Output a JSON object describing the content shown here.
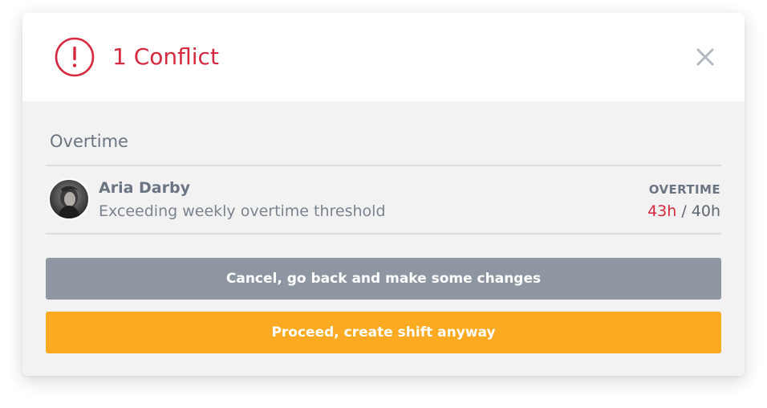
{
  "dialog": {
    "title": "1 Conflict",
    "alert_icon": "exclamation-circle-icon",
    "close_icon": "close-icon",
    "accent_color": "#d6283e"
  },
  "section": {
    "title": "Overtime"
  },
  "conflict": {
    "employee_name": "Aria Darby",
    "avatar": "employee-photo",
    "detail": "Exceeding weekly overtime threshold",
    "label": "OVERTIME",
    "current_hours": "43h",
    "separator": " / ",
    "limit_hours": "40h"
  },
  "actions": {
    "cancel_label": "Cancel, go back and make some changes",
    "cancel_color": "#8e97a1",
    "proceed_label": "Proceed, create shift anyway",
    "proceed_color": "#fcaa22"
  }
}
